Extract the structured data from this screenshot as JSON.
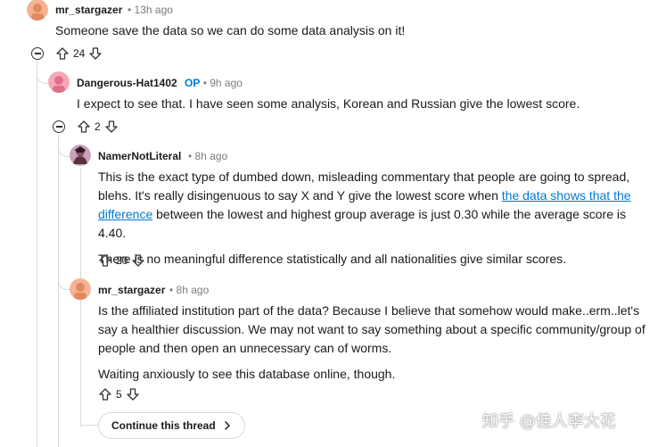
{
  "comments": [
    {
      "username": "mr_stargazer",
      "op": "",
      "time": "13h ago",
      "paragraphs": [
        "Someone save the data so we can do some data analysis on it!"
      ],
      "votes": "24",
      "avatar_colors": [
        "#f4b393",
        "#e08a5f"
      ]
    },
    {
      "username": "Dangerous-Hat1402",
      "op": "OP",
      "time": "9h ago",
      "paragraphs": [
        "I expect to see that. I have seen some analysis, Korean and Russian give the lowest score."
      ],
      "votes": "2",
      "avatar_colors": [
        "#f7a8b8",
        "#e07088"
      ]
    },
    {
      "username": "NamerNotLiteral",
      "op": "",
      "time": "8h ago",
      "p1_before": "This is the exact type of dumbed down, misleading commentary that people are going to spread, blehs. It's really disingenuous to say X and Y give the lowest score when ",
      "p1_link": "the data shows that the difference",
      "p1_after": " between the lowest and highest group average is just 0.30 while the average score is 4.40.",
      "p2": "There is no meaningful difference statistically and all nationalities give similar scores.",
      "votes": "20",
      "avatar_colors": [
        "#c9a0b8",
        "#5a3040"
      ]
    },
    {
      "username": "mr_stargazer",
      "op": "",
      "time": "8h ago",
      "paragraphs": [
        "Is the affiliated institution part of the data? Because I believe that somehow would make..erm..let's say a healthier discussion. We may not want to say something about a specific community/group of people and then open an unnecessary can of worms.",
        "Waiting anxiously to see this database online, though."
      ],
      "votes": "5",
      "avatar_colors": [
        "#f4b393",
        "#e08a5f"
      ]
    }
  ],
  "sep": "•",
  "continue_label": "Continue this thread",
  "watermark": "知乎 @佳人李大花"
}
